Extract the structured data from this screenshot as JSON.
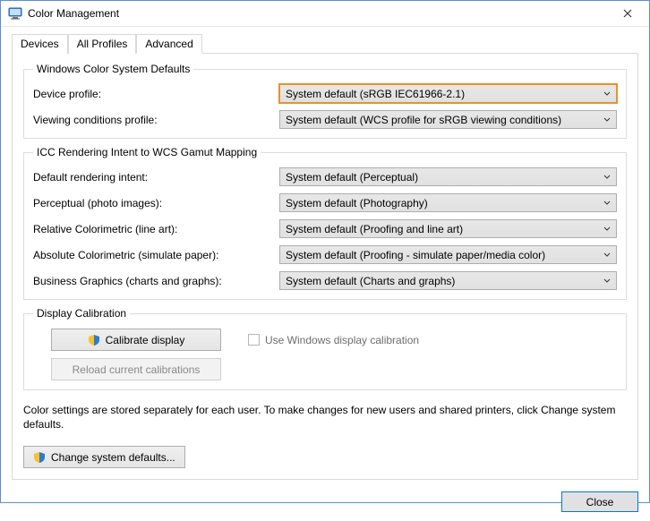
{
  "window": {
    "title": "Color Management",
    "close_label": "Close"
  },
  "tabs": {
    "devices": "Devices",
    "all_profiles": "All Profiles",
    "advanced": "Advanced"
  },
  "wcs_defaults": {
    "legend": "Windows Color System Defaults",
    "device_profile_label": "Device profile:",
    "device_profile_value": "System default (sRGB IEC61966-2.1)",
    "viewing_conditions_label": "Viewing conditions profile:",
    "viewing_conditions_value": "System default (WCS profile for sRGB viewing conditions)"
  },
  "icc_mapping": {
    "legend": "ICC Rendering Intent to WCS Gamut Mapping",
    "default_intent_label": "Default rendering intent:",
    "default_intent_value": "System default (Perceptual)",
    "perceptual_label": "Perceptual (photo images):",
    "perceptual_value": "System default (Photography)",
    "relative_label": "Relative Colorimetric (line art):",
    "relative_value": "System default (Proofing and line art)",
    "absolute_label": "Absolute Colorimetric (simulate paper):",
    "absolute_value": "System default (Proofing - simulate paper/media color)",
    "business_label": "Business Graphics (charts and graphs):",
    "business_value": "System default (Charts and graphs)"
  },
  "calibration": {
    "legend": "Display Calibration",
    "calibrate_btn": "Calibrate display",
    "reload_btn": "Reload current calibrations",
    "use_windows_label": "Use Windows display calibration"
  },
  "footer": {
    "text": "Color settings are stored separately for each user. To make changes for new users and shared printers, click Change system defaults.",
    "change_defaults_btn": "Change system defaults..."
  }
}
